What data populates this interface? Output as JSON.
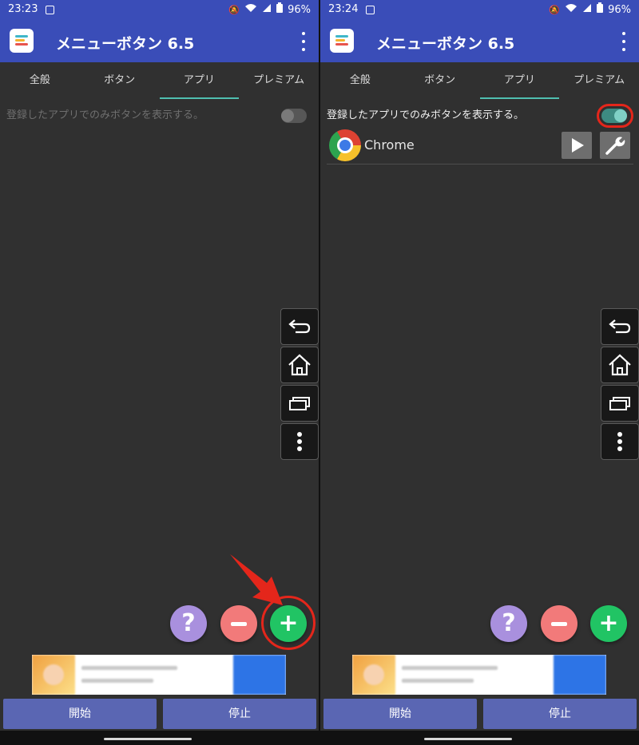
{
  "left": {
    "status": {
      "time": "23:23",
      "battery": "96%"
    },
    "app": {
      "title": "メニューボタン 6.5"
    },
    "tabs": [
      "全般",
      "ボタン",
      "アプリ",
      "プレミアム"
    ],
    "active_tab": "アプリ",
    "setting": {
      "label": "登録したアプリでのみボタンを表示する。",
      "enabled": false
    },
    "nav_buttons": [
      "back-icon",
      "home-icon",
      "recents-icon",
      "more-vert-icon"
    ],
    "fabs": {
      "help": "?",
      "minus": "−",
      "plus": "+"
    },
    "bottom": {
      "start": "開始",
      "stop": "停止"
    }
  },
  "right": {
    "status": {
      "time": "23:24",
      "battery": "96%"
    },
    "app": {
      "title": "メニューボタン 6.5"
    },
    "tabs": [
      "全般",
      "ボタン",
      "アプリ",
      "プレミアム"
    ],
    "active_tab": "アプリ",
    "setting": {
      "label": "登録したアプリでのみボタンを表示する。",
      "enabled": true
    },
    "apps": [
      {
        "name": "Chrome",
        "icon": "chrome-icon"
      }
    ],
    "nav_buttons": [
      "back-icon",
      "home-icon",
      "recents-icon",
      "more-vert-icon"
    ],
    "fabs": {
      "help": "?",
      "minus": "−",
      "plus": "+"
    },
    "bottom": {
      "start": "開始",
      "stop": "停止"
    }
  },
  "colors": {
    "appbar": "#3a4db8",
    "background": "#303030",
    "tab_indicator": "#4fbfb0",
    "help_fab": "#a990de",
    "minus_fab": "#f27a7a",
    "plus_fab": "#21c464",
    "bottom_button": "#5a66b3",
    "annotation": "#e4261b"
  }
}
